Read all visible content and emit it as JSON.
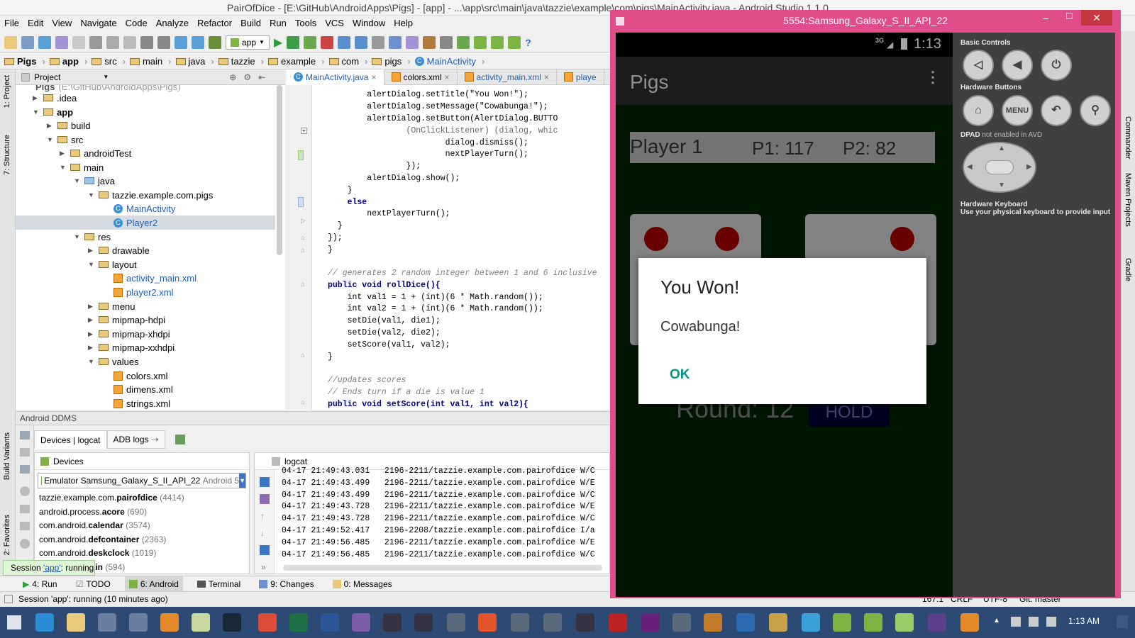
{
  "window": {
    "title": "PairOfDice - [E:\\GitHub\\AndroidApps\\Pigs] - [app] - ...\\app\\src\\main\\java\\tazzie\\example\\com\\pigs\\MainActivity.java - Android Studio 1.1.0"
  },
  "menu": [
    "File",
    "Edit",
    "View",
    "Navigate",
    "Code",
    "Analyze",
    "Refactor",
    "Build",
    "Run",
    "Tools",
    "VCS",
    "Window",
    "Help"
  ],
  "toolbar": {
    "run_config": "app"
  },
  "breadcrumb": [
    "Pigs",
    "app",
    "src",
    "main",
    "java",
    "tazzie",
    "example",
    "com",
    "pigs",
    "MainActivity"
  ],
  "left_strip": {
    "project": "1: Project",
    "structure": "7: Structure",
    "build_variants": "Build Variants",
    "favorites": "2: Favorites"
  },
  "project": {
    "header": "Project",
    "root": "Pigs",
    "root_path": "(E:\\GitHub\\AndroidApps\\Pigs)",
    "tree": [
      ".idea",
      "app",
      "build",
      "src",
      "androidTest",
      "main",
      "java",
      "tazzie.example.com.pigs",
      "MainActivity",
      "Player2",
      "res",
      "drawable",
      "layout",
      "activity_main.xml",
      "player2.xml",
      "menu",
      "mipmap-hdpi",
      "mipmap-xhdpi",
      "mipmap-xxhdpi",
      "values",
      "colors.xml",
      "dimens.xml",
      "strings.xml"
    ]
  },
  "editor_tabs": [
    "MainActivity.java",
    "colors.xml",
    "activity_main.xml",
    "playe"
  ],
  "code": [
    "        alertDialog.setTitle(\"You Won!\");",
    "        alertDialog.setMessage(\"Cowabunga!\");",
    "        alertDialog.setButton(AlertDialog.BUTTO",
    "                (OnClickListener) (dialog, whic",
    "                        dialog.dismiss();",
    "                        nextPlayerTurn();",
    "                });",
    "        alertDialog.show();",
    "    }",
    "    else",
    "        nextPlayerTurn();",
    "  }",
    "});",
    "}",
    "",
    "// generates 2 random integer between 1 and 6 inclusive",
    "public void rollDice(){",
    "    int val1 = 1 + (int)(6 * Math.random());",
    "    int val2 = 1 + (int)(6 * Math.random());",
    "    setDie(val1, die1);",
    "    setDie(val2, die2);",
    "    setScore(val1, val2);",
    "}",
    "",
    "//updates scores",
    "// Ends turn if a die is value 1",
    "public void setScore(int val1, int val2){"
  ],
  "ddms": {
    "title": "Android DDMS",
    "tab_devices": "Devices | logcat",
    "tab_adb": "ADB logs",
    "devices_label": "Devices",
    "device": "Emulator Samsung_Galaxy_S_II_API_22",
    "device_suffix": "Android 5",
    "processes": [
      {
        "prefix": "tazzie.example.com.",
        "bold": "pairofdice",
        "pid": "(4414)"
      },
      {
        "prefix": "android.process.",
        "bold": "acore",
        "pid": "(690)"
      },
      {
        "prefix": "com.android.",
        "bold": "calendar",
        "pid": "(3574)"
      },
      {
        "prefix": "com.android.",
        "bold": "defcontainer",
        "pid": "(2363)"
      },
      {
        "prefix": "com.android.",
        "bold": "deskclock",
        "pid": "(1019)"
      },
      {
        "prefix": "",
        "bold": "putmethod.latin",
        "pid": "(594)"
      }
    ],
    "logcat_title": "logcat",
    "log": [
      "04-17 21:49:43.031   2196-2211/tazzie.example.com.pairofdice W/C",
      "04-17 21:49:43.499   2196-2211/tazzie.example.com.pairofdice W/E",
      "04-17 21:49:43.499   2196-2211/tazzie.example.com.pairofdice W/C",
      "04-17 21:49:43.728   2196-2211/tazzie.example.com.pairofdice W/E",
      "04-17 21:49:43.728   2196-2211/tazzie.example.com.pairofdice W/C",
      "04-17 21:49:52.417   2196-2208/tazzie.example.com.pairofdice I/a",
      "04-17 21:49:56.485   2196-2211/tazzie.example.com.pairofdice W/E",
      "04-17 21:49:56.485   2196-2211/tazzie.example.com.pairofdice W/C"
    ]
  },
  "session": {
    "prefix": "Session ",
    "app": "'app'",
    "suffix": ": running"
  },
  "bottom_tabs": [
    "4: Run",
    "TODO",
    "6: Android",
    "Terminal",
    "9: Changes",
    "0: Messages"
  ],
  "status": {
    "message": "Session 'app': running (10 minutes ago)",
    "position": "167:1",
    "line_sep": "CRLF",
    "encoding": "UTF-8",
    "git": "Git: master"
  },
  "taskbar": {
    "time": "1:13 AM"
  },
  "emulator": {
    "title": "5554:Samsung_Galaxy_S_II_API_22",
    "net": "3G",
    "clock": "1:13",
    "app_title": "Pigs",
    "player": "Player 1",
    "p1": "P1: 117",
    "p2": "P2: 82",
    "round": "Round: 12",
    "hold": "HOLD",
    "dialog": {
      "title": "You Won!",
      "message": "Cowabunga!",
      "ok": "OK"
    },
    "controls": {
      "basic": "Basic Controls",
      "hw": "Hardware Buttons",
      "menu": "MENU",
      "dpad_a": "DPAD",
      "dpad_b": " not enabled in AVD",
      "kb_title": "Hardware Keyboard",
      "kb_text": "Use your physical keyboard to provide input"
    }
  },
  "right_strip": [
    "Commander",
    "Maven Projects",
    "Gradle"
  ],
  "colors": {
    "accent": "#009688",
    "emulator_frame": "#e04d8a",
    "die_pip": "#a00000",
    "board": "#002200"
  }
}
